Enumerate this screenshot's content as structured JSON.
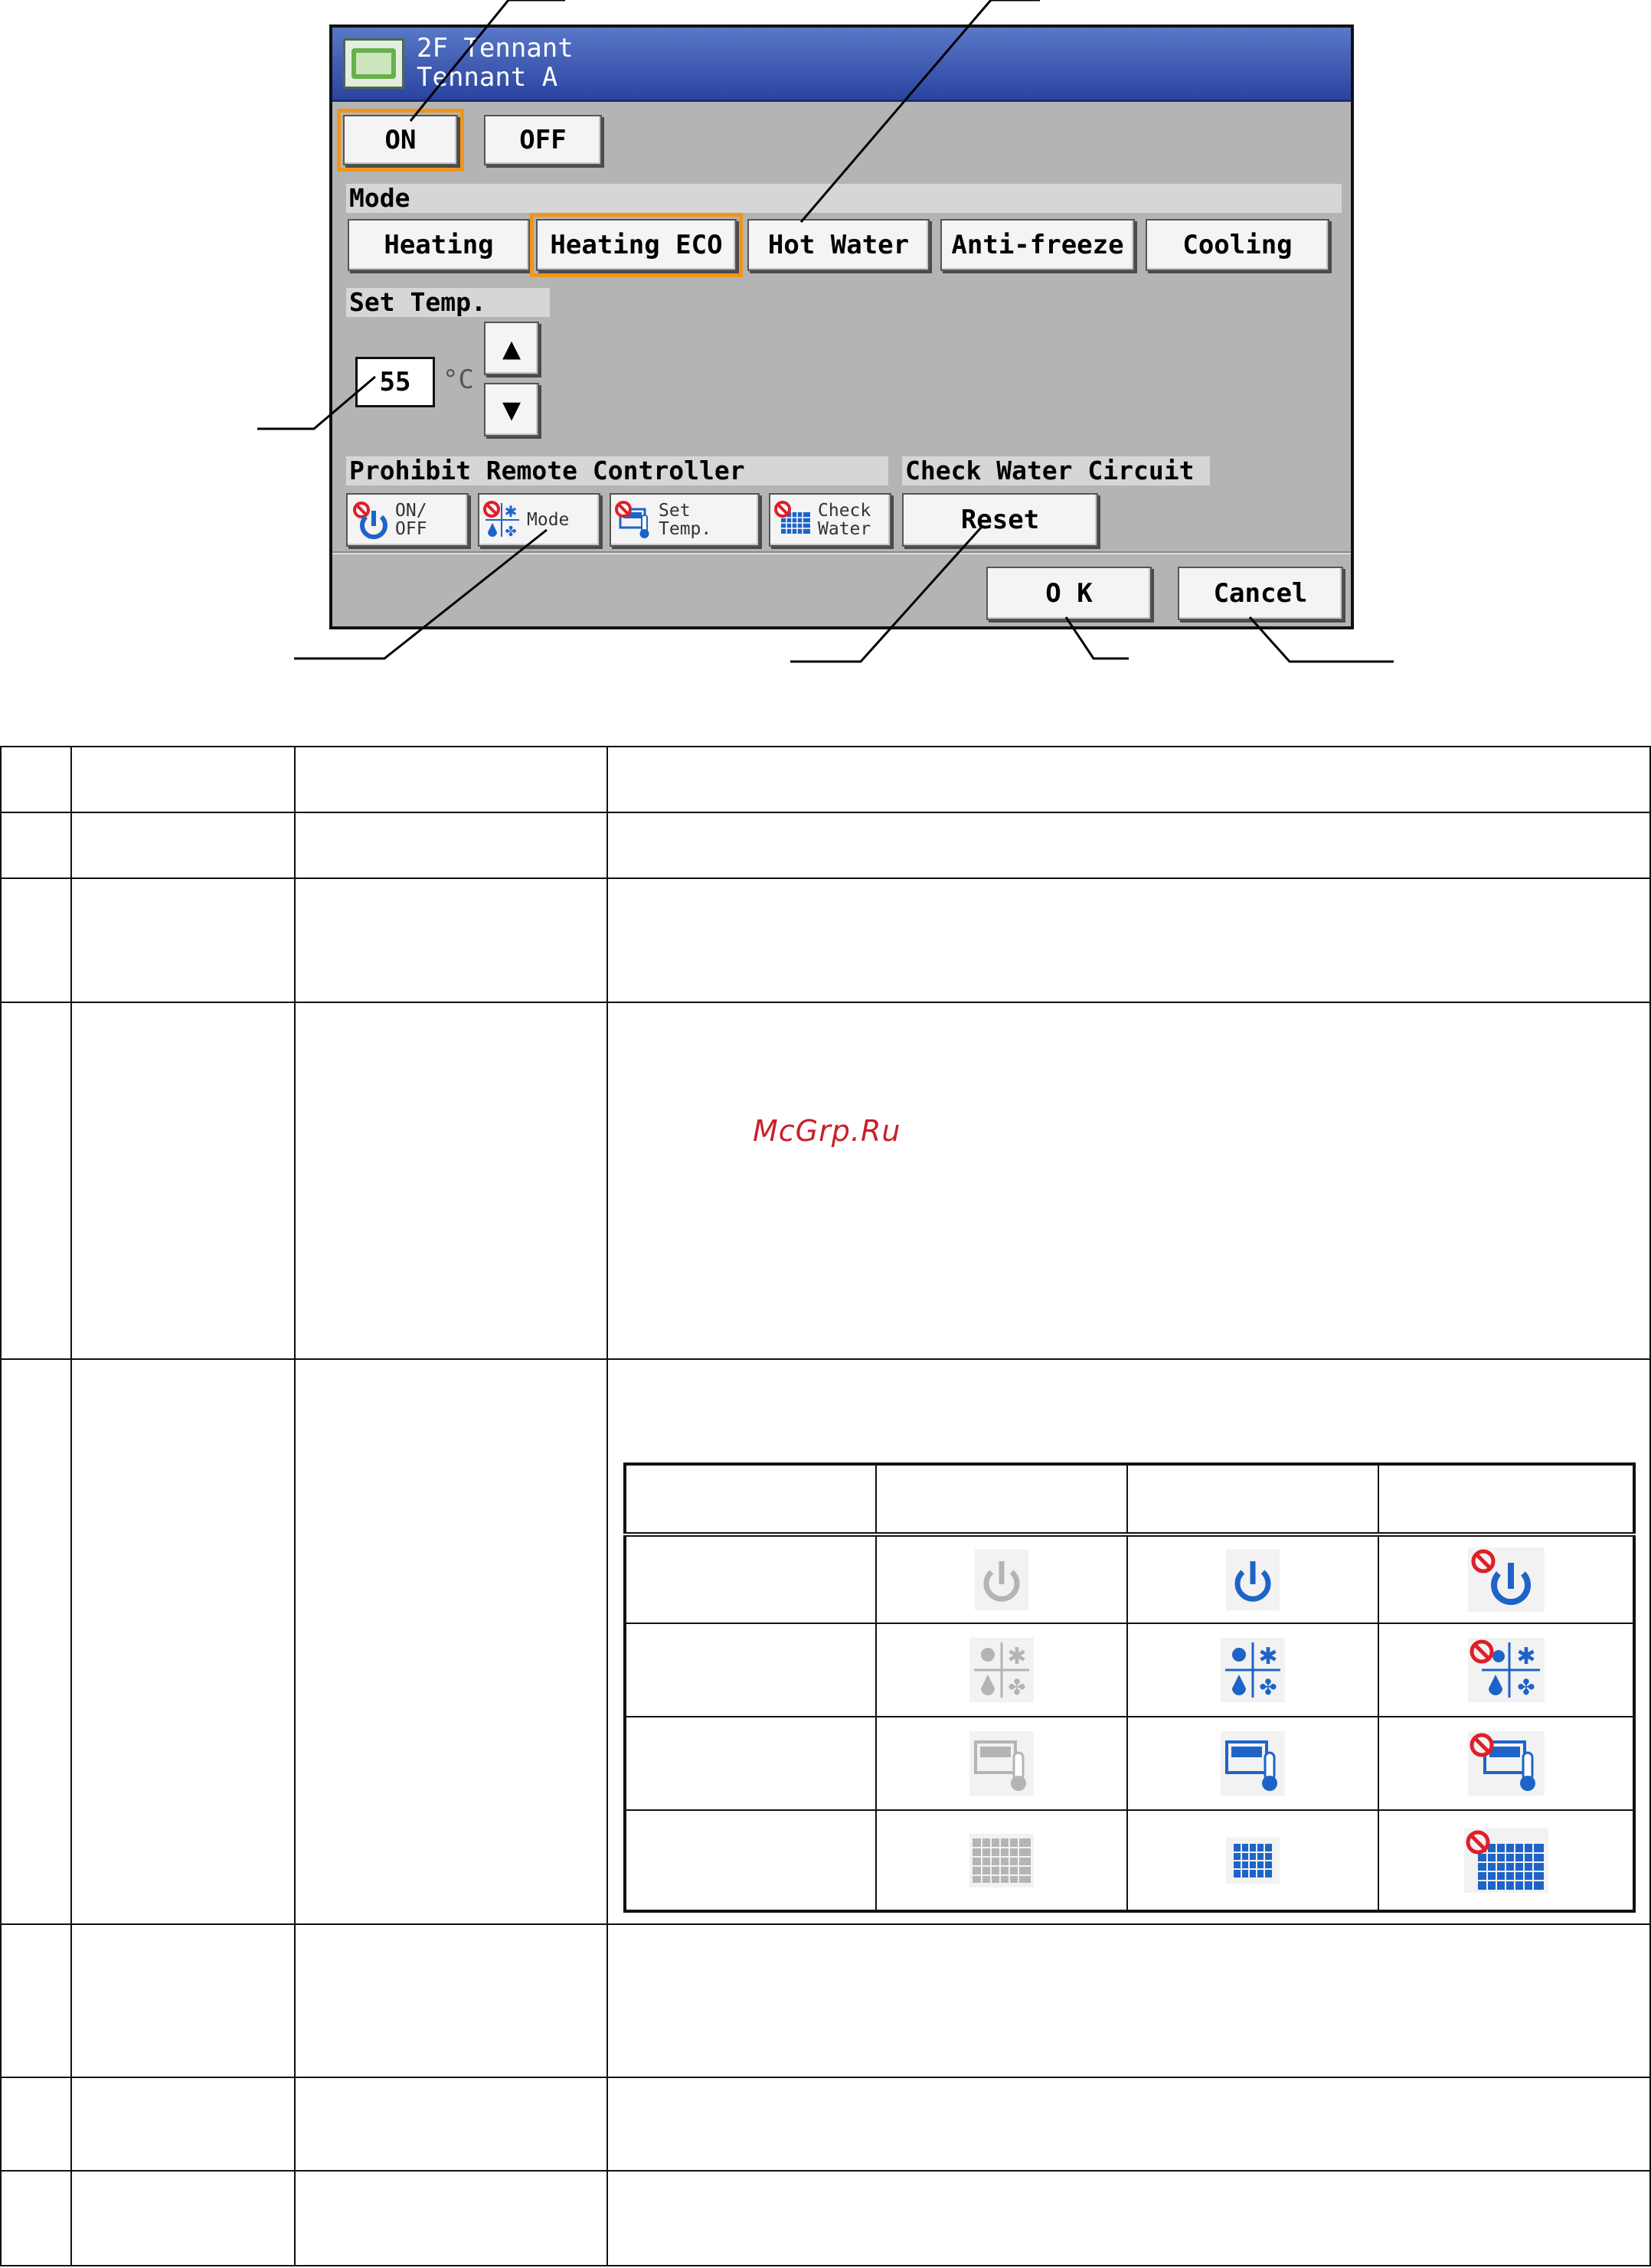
{
  "screen": {
    "title_line1": "2F Tennant",
    "title_line2": "Tennant A",
    "on_label": "ON",
    "off_label": "OFF",
    "mode_label": "Mode",
    "modes": [
      "Heating",
      "Heating ECO",
      "Hot Water",
      "Anti-freeze",
      "Cooling"
    ],
    "selected_mode": "Heating ECO",
    "set_temp_label": "Set Temp.",
    "set_temp_value": "55",
    "temp_unit": "°C",
    "up_arrow": "▲",
    "down_arrow": "▼",
    "prohibit_label": "Prohibit Remote Controller",
    "prohibit_buttons": [
      {
        "line1": "ON/",
        "line2": "OFF"
      },
      {
        "line1": "Mode",
        "line2": ""
      },
      {
        "line1": "Set",
        "line2": "Temp."
      },
      {
        "line1": "Check",
        "line2": "Water"
      }
    ],
    "check_water_label": "Check Water Circuit",
    "reset_label": "Reset",
    "ok_label": "O K",
    "cancel_label": "Cancel"
  },
  "watermark": "McGrp.Ru",
  "colors": {
    "title_bar": "#2a44a0",
    "screen_bg": "#b4b4b4",
    "selected_outline": "#f0951a",
    "icon_blue": "#1e64c8",
    "icon_gray": "#b4b4b4",
    "prohibit_red": "#e01e28"
  },
  "icon_table": {
    "rows": [
      "power-icon",
      "mode-icon",
      "set-temp-icon",
      "check-water-icon"
    ],
    "states": [
      "gray",
      "blue",
      "blue-prohibited"
    ]
  }
}
